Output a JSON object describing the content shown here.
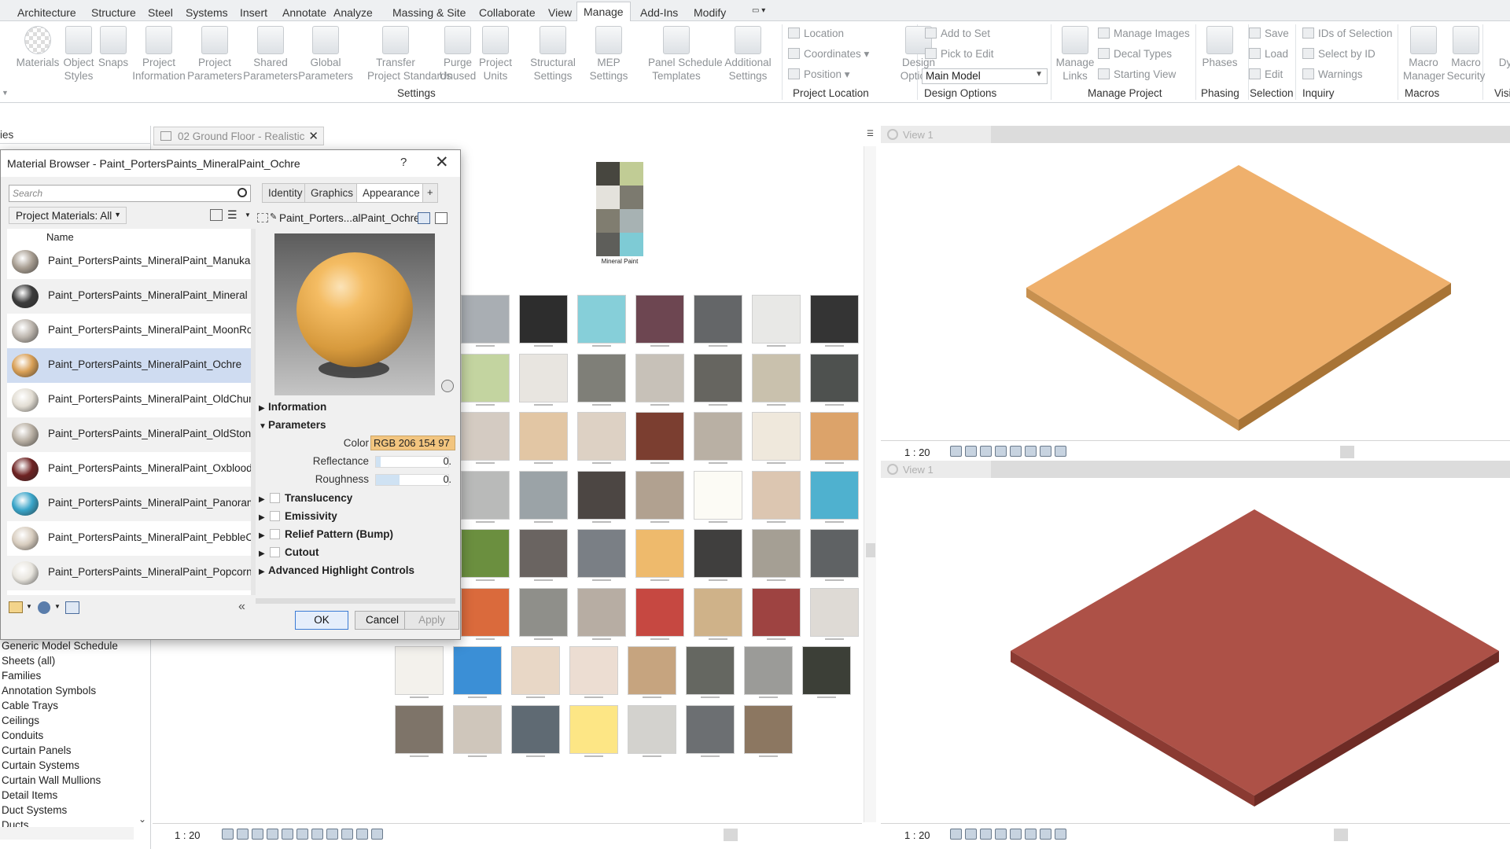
{
  "ribbon": {
    "tabs": [
      "Architecture",
      "Structure",
      "Steel",
      "Systems",
      "Insert",
      "Annotate",
      "Analyze",
      "Massing & Site",
      "Collaborate",
      "View",
      "Manage",
      "Add-Ins",
      "Modify"
    ],
    "active_tab": "Manage",
    "settings_buttons": [
      {
        "label1": "Materials",
        "label2": ""
      },
      {
        "label1": "Object",
        "label2": "Styles"
      },
      {
        "label1": "Snaps",
        "label2": ""
      },
      {
        "label1": "Project",
        "label2": "Information"
      },
      {
        "label1": "Project",
        "label2": "Parameters"
      },
      {
        "label1": "Shared",
        "label2": "Parameters"
      },
      {
        "label1": "Global",
        "label2": "Parameters"
      },
      {
        "label1": "Transfer",
        "label2": "Project Standards"
      },
      {
        "label1": "Purge",
        "label2": "Unused"
      },
      {
        "label1": "Project",
        "label2": "Units"
      },
      {
        "label1": "Structural",
        "label2": "Settings"
      },
      {
        "label1": "MEP",
        "label2": "Settings"
      },
      {
        "label1": "Panel Schedule",
        "label2": "Templates"
      },
      {
        "label1": "Additional",
        "label2": "Settings"
      }
    ],
    "groups": {
      "settings": "Settings",
      "project_location": "Project Location",
      "design_options": "Design Options",
      "manage_project": "Manage Project",
      "phasing": "Phasing",
      "selection": "Selection",
      "inquiry": "Inquiry",
      "macros": "Macros",
      "vis_partial": "Visi"
    },
    "location_items": [
      "Location",
      "Coordinates",
      "Position"
    ],
    "design_options_button": {
      "label1": "Design",
      "label2": "Options"
    },
    "design_small": [
      "Add to Set",
      "Pick to Edit"
    ],
    "main_model": "Main Model",
    "manage_links": {
      "label1": "Manage",
      "label2": "Links"
    },
    "manage_small": [
      "Manage Images",
      "Decal Types",
      "Starting View"
    ],
    "phases": "Phases",
    "selection_small": [
      "Save",
      "Load",
      "Edit"
    ],
    "inquiry_small": [
      "IDs of Selection",
      "Select by ID",
      "Warnings"
    ],
    "macro_manager": {
      "label1": "Macro",
      "label2": "Manager"
    },
    "macro_security": {
      "label1": "Macro",
      "label2": "Security"
    },
    "dy_partial": "Dy"
  },
  "project_browser": {
    "header_partial": "ies",
    "items": [
      "Generic Model Schedule",
      "Sheets (all)",
      "Families",
      "Annotation Symbols",
      "Cable Trays",
      "Ceilings",
      "Conduits",
      "Curtain Panels",
      "Curtain Systems",
      "Curtain Wall Mullions",
      "Detail Items",
      "Duct Systems",
      "Ducts"
    ]
  },
  "main_view": {
    "tab_label": "02 Ground Floor - Realistic",
    "scale": "1 : 20",
    "mineral_paint_title": "Mineral Paint"
  },
  "right_views": {
    "top_tab": "View 1",
    "bottom_tab": "View 1",
    "top_scale": "1 : 20",
    "bottom_scale": "1 : 20",
    "top_color": "#efb06c",
    "bottom_color": "#ad5147"
  },
  "material_browser": {
    "title": "Material Browser - Paint_PortersPaints_MineralPaint_Ochre",
    "help": "?",
    "search_placeholder": "Search",
    "filter": "Project Materials: All",
    "column_name": "Name",
    "materials": [
      {
        "name": "Paint_PortersPaints_MineralPaint_Manuka",
        "color": "#a89e92",
        "selected": false
      },
      {
        "name": "Paint_PortersPaints_MineralPaint_Mineral",
        "color": "#3c3c3c",
        "selected": false
      },
      {
        "name": "Paint_PortersPaints_MineralPaint_MoonRock",
        "color": "#bdb6ae",
        "selected": false
      },
      {
        "name": "Paint_PortersPaints_MineralPaint_Ochre",
        "color": "#d9a057",
        "selected": true
      },
      {
        "name": "Paint_PortersPaints_MineralPaint_OldChurchW",
        "color": "#e2ddd3",
        "selected": false
      },
      {
        "name": "Paint_PortersPaints_MineralPaint_OldStoneW",
        "color": "#b9b0a4",
        "selected": false
      },
      {
        "name": "Paint_PortersPaints_MineralPaint_Oxblood",
        "color": "#6e2323",
        "selected": false
      },
      {
        "name": "Paint_PortersPaints_MineralPaint_Panorama",
        "color": "#3aa5c9",
        "selected": false
      },
      {
        "name": "Paint_PortersPaints_MineralPaint_PebbleCrea",
        "color": "#d8cdbf",
        "selected": false
      },
      {
        "name": "Paint_PortersPaints_MineralPaint_Popcorn",
        "color": "#e9e6df",
        "selected": false
      }
    ],
    "tabs": [
      "Identity",
      "Graphics",
      "Appearance"
    ],
    "active_tab": "Appearance",
    "add_tab": "+",
    "asset_name": "Paint_Porters...alPaint_Ochre",
    "sections": {
      "information": "Information",
      "parameters": "Parameters",
      "translucency": "Translucency",
      "emissivity": "Emissivity",
      "relief": "Relief Pattern (Bump)",
      "cutout": "Cutout",
      "advanced": "Advanced Highlight Controls"
    },
    "params": {
      "color_label": "Color",
      "color_value": "RGB 206 154 97",
      "reflectance_label": "Reflectance",
      "reflectance_value": "0.",
      "roughness_label": "Roughness",
      "roughness_value": "0."
    },
    "buttons": {
      "ok": "OK",
      "cancel": "Cancel",
      "apply": "Apply"
    }
  },
  "swatch_grid": {
    "rows": [
      [
        "#a9aeb3",
        "#2d2d2d",
        "#86cfd9",
        "#6d4651",
        "#646668",
        "#e8e8e6",
        "#343434"
      ],
      [
        "#c3d4a0",
        "#e8e5e0",
        "#7f7f78",
        "#c7c1b8",
        "#666560",
        "#c9c1ad",
        "#4e514f"
      ],
      [
        "#d4cbc2",
        "#e2c6a4",
        "#ddd1c4",
        "#7b3e30",
        "#b9b0a4",
        "#efe8dc",
        "#dca36a"
      ],
      [
        "#b9bab9",
        "#9ba3a7",
        "#4c4643",
        "#b1a190",
        "#fcfbf5",
        "#dcc6b1",
        "#4fb1cf"
      ],
      [
        "#6b8f3f",
        "#6a6461",
        "#7a7f85",
        "#eeba6c",
        "#403f3e",
        "#a59f94",
        "#5f6264"
      ],
      [
        "#da6a3c",
        "#8f8f8a",
        "#b7ada3",
        "#c64841",
        "#cfb289",
        "#9e4341",
        "#dedad5"
      ],
      [
        "#f3f1ec",
        "#3b8fd6",
        "#e8d7c6",
        "#ecddd2",
        "#c6a47f",
        "#656761",
        "#9b9b98",
        "#3c3f37"
      ],
      [
        "#7e7469",
        "#cfc6bb",
        "#5f6a73",
        "#fde685",
        "#d3d2ce",
        "#6c6f72",
        "#8c7761"
      ]
    ],
    "mineral_chips": [
      [
        "#47463f",
        "#c1cc95"
      ],
      [
        "#e4e2dc",
        "#7c7a6f"
      ],
      [
        "#807d70",
        "#a7b2b3"
      ],
      [
        "#5e5e5a",
        "#7ecbd5"
      ]
    ]
  }
}
